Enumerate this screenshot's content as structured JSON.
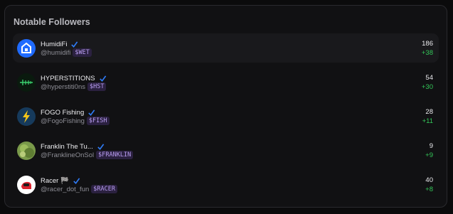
{
  "panel": {
    "title": "Notable Followers"
  },
  "followers": [
    {
      "name": "HumidiFi",
      "handle": "@humidifi",
      "ticker": "$WET",
      "count": "186",
      "delta": "+38",
      "verified": true,
      "avatar_icon": "humidifi-logo-icon"
    },
    {
      "name": "HYPERSTITIONS",
      "handle": "@hyperstiti0ns",
      "ticker": "$HST",
      "count": "54",
      "delta": "+30",
      "verified": true,
      "avatar_icon": "hyperstitions-logo-icon"
    },
    {
      "name": "FOGO Fishing",
      "handle": "@FogoFishing",
      "ticker": "$FISH",
      "count": "28",
      "delta": "+11",
      "verified": true,
      "avatar_icon": "fogo-lightning-icon"
    },
    {
      "name": "Franklin The Tu...",
      "handle": "@FranklineOnSol",
      "ticker": "$FRANKLIN",
      "count": "9",
      "delta": "+9",
      "verified": true,
      "avatar_icon": "franklin-turtle-avatar"
    },
    {
      "name": "Racer 🏁",
      "handle": "@racer_dot_fun",
      "ticker": "$RACER",
      "count": "40",
      "delta": "+8",
      "verified": true,
      "avatar_icon": "racer-helmet-icon"
    }
  ],
  "colors": {
    "verified": "#2f7bf6",
    "delta": "#34c759",
    "ticker_bg": "#2b2140",
    "ticker_fg": "#b89cf0"
  }
}
